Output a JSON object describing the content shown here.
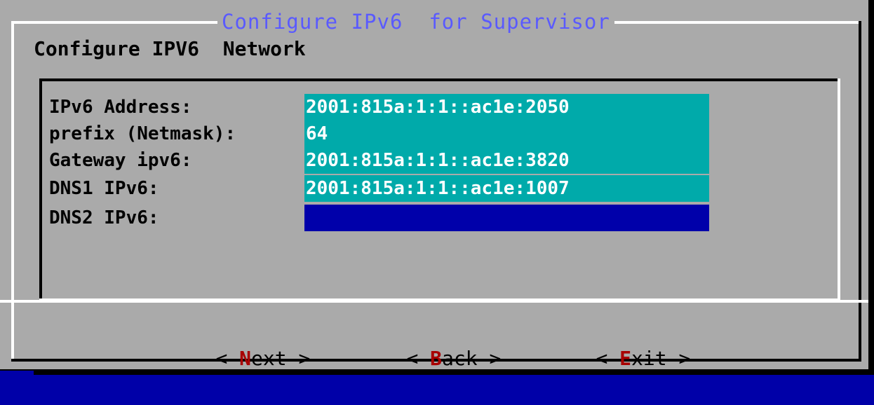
{
  "dialog": {
    "title": "Configure IPv6  for Supervisor",
    "subtitle": "Configure IPV6  Network"
  },
  "form": {
    "fields": [
      {
        "label": "IPv6 Address:",
        "value": "2001:815a:1:1::ac1e:2050",
        "state": "teal"
      },
      {
        "label": "prefix (Netmask):",
        "value": "64",
        "state": "teal"
      },
      {
        "label": "Gateway ipv6:",
        "value": "2001:815a:1:1::ac1e:3820",
        "state": "teal"
      },
      {
        "label": "DNS1 IPv6:",
        "value": "2001:815a:1:1::ac1e:1007",
        "state": "teal"
      },
      {
        "label": "DNS2 IPv6:",
        "value": "",
        "state": "focused"
      }
    ]
  },
  "buttons": {
    "next": {
      "open": "< ",
      "hotkey": "N",
      "rest": "ext",
      "close": " >"
    },
    "back": {
      "open": "< ",
      "hotkey": "B",
      "rest": "ack",
      "close": " >"
    },
    "exit": {
      "open": "< ",
      "hotkey": "E",
      "rest": "xit",
      "close": " >"
    }
  },
  "colors": {
    "dialog_bg": "#aaaaaa",
    "title": "#5a5aff",
    "field_teal": "#00aaaa",
    "field_focused": "#0000aa",
    "hotkey": "#a80000",
    "screen_bg": "#0000a8"
  }
}
